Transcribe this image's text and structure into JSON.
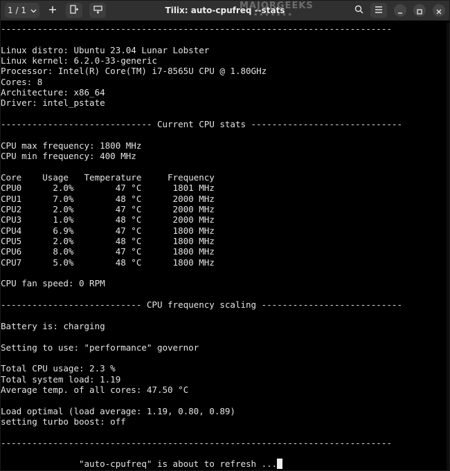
{
  "window": {
    "title": "Tilix: auto-cpufreq --stats",
    "session_label": "1 / 1",
    "watermark": "MAJORGEEKS",
    "watermark_stars": "★★★★★★★"
  },
  "terminal": {
    "lines": [
      "---------------------------------------------------------------------------",
      "",
      "Linux distro: Ubuntu 23.04 Lunar Lobster",
      "Linux kernel: 6.2.0-33-generic",
      "Processor: Intel(R) Core(TM) i7-8565U CPU @ 1.80GHz",
      "Cores: 8",
      "Architecture: x86_64",
      "Driver: intel_pstate",
      "",
      "----------------------------- Current CPU stats -----------------------------",
      "",
      "CPU max frequency: 1800 MHz",
      "CPU min frequency: 400 MHz",
      "",
      "Core    Usage   Temperature     Frequency",
      "CPU0      2.0%        47 °C      1801 MHz",
      "CPU1      7.0%        48 °C      2000 MHz",
      "CPU2      2.0%        47 °C      2000 MHz",
      "CPU3      1.0%        48 °C      2000 MHz",
      "CPU4      6.9%        47 °C      1800 MHz",
      "CPU5      2.0%        48 °C      1800 MHz",
      "CPU6      8.0%        47 °C      1800 MHz",
      "CPU7      5.0%        48 °C      1800 MHz",
      "",
      "CPU fan speed: 0 RPM",
      "",
      "--------------------------- CPU frequency scaling ---------------------------",
      "",
      "Battery is: charging",
      "",
      "Setting to use: \"performance\" governor",
      "",
      "Total CPU usage: 2.3 %",
      "Total system load: 1.19",
      "Average temp. of all cores: 47.50 °C",
      "",
      "Load optimal (load average: 1.19, 0.80, 0.89)",
      "setting turbo boost: off",
      "",
      "---------------------------------------------------------------------------",
      "",
      "               \"auto-cpufreq\" is about to refresh ..."
    ]
  },
  "colors": {
    "background": "#000000",
    "foreground": "#e4e4e4",
    "headerbar": "#303030"
  }
}
